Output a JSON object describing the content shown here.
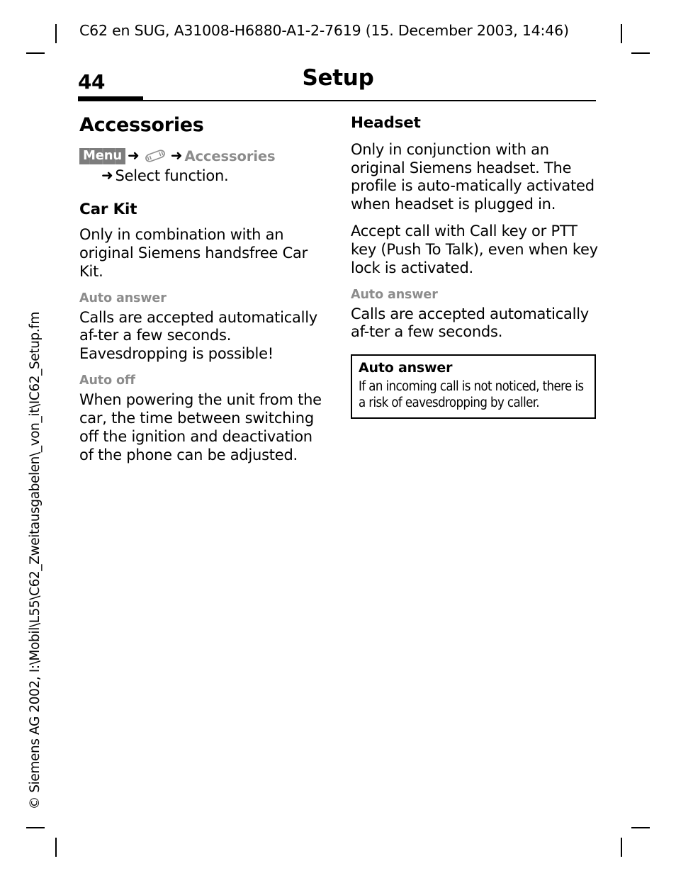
{
  "document_header": "C62 en SUG, A31008-H6880-A1-2-7619 (15. December 2003, 14:46)",
  "page": {
    "number": "44",
    "title": "Setup"
  },
  "sidenote": "© Siemens AG 2002, I:\\Mobil\\L55\\C62_Zweitausgabelen\\_von_it\\IC62_Setup.fm",
  "left_column": {
    "heading": "Accessories",
    "menu_path": {
      "softkey_label": "Menu",
      "arrow_glyph": "➜",
      "icon_name": "wrench-icon",
      "target": "Accessories",
      "second_line": "Select function."
    },
    "sections": [
      {
        "heading": "Car Kit",
        "body": "Only in combination with an original Siemens handsfree Car Kit.",
        "subsections": [
          {
            "heading": "Auto answer",
            "body": "Calls are accepted automatically af-ter a few seconds. Eavesdropping is possible!"
          },
          {
            "heading": "Auto off",
            "body": "When powering the unit from the car, the time between switching off the ignition and deactivation of the phone can be adjusted."
          }
        ]
      }
    ]
  },
  "right_column": {
    "heading": "Headset",
    "paragraphs": [
      "Only in conjunction with an original Siemens headset. The profile is auto-matically activated when headset is plugged in.",
      "Accept call with Call key or PTT key (Push To Talk), even when key lock is activated."
    ],
    "subsection": {
      "heading": "Auto answer",
      "body": "Calls are accepted automatically af-ter a few seconds."
    },
    "callout": {
      "title": "Auto answer",
      "body": "If an incoming call is not noticed, there is a risk of eavesdropping by caller."
    }
  },
  "colors": {
    "text": "#000000",
    "muted": "#8c8c8c",
    "softkey_bg": "#7d7d7d",
    "rule": "#000000"
  }
}
